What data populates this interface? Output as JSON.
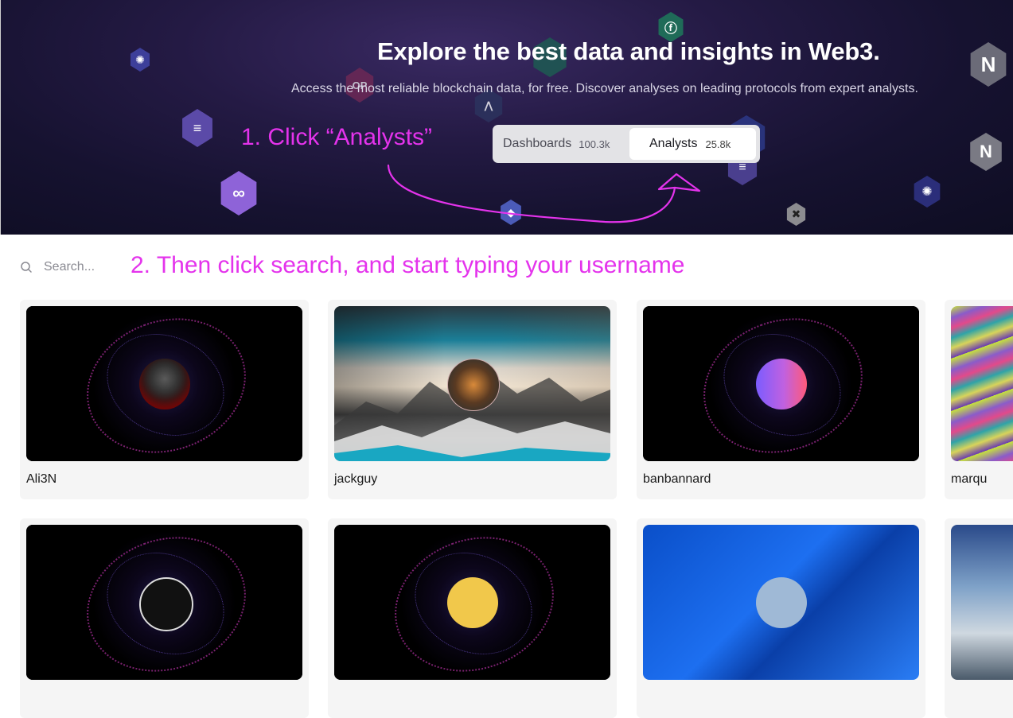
{
  "hero": {
    "title": "Explore the best data and insights in Web3.",
    "subtitle": "Access the most reliable blockchain data, for free. Discover analyses on leading protocols from expert analysts.",
    "tabs": [
      {
        "label": "Dashboards",
        "count": "100.3k",
        "selected": false
      },
      {
        "label": "Analysts",
        "count": "25.8k",
        "selected": true
      }
    ],
    "annotation": "1. Click “Analysts”",
    "annotation_color": "#e433ec"
  },
  "search": {
    "placeholder": "Search...",
    "annotation": "2. Then click search, and start typing your username"
  },
  "analysts": [
    {
      "name": "Ali3N"
    },
    {
      "name": "jackguy"
    },
    {
      "name": "banbannard"
    },
    {
      "name": "marqu"
    },
    {
      "name": ""
    },
    {
      "name": ""
    },
    {
      "name": ""
    },
    {
      "name": ""
    }
  ],
  "icons": [
    "search-icon",
    "cosmos-icon",
    "solana-icon",
    "polygon-icon",
    "near-icon",
    "optimism-icon",
    "ethereum-icon",
    "flow-icon",
    "arbitrum-icon",
    "x-icon"
  ]
}
